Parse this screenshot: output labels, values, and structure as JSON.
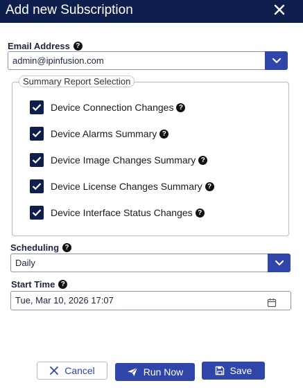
{
  "dialog": {
    "title": "Add new Subscription"
  },
  "email": {
    "label": "Email Address",
    "value": "admin@ipinfusion.com"
  },
  "summary": {
    "legend": "Summary Report Selection",
    "items": [
      {
        "label": "Device Connection Changes",
        "checked": true
      },
      {
        "label": "Device Alarms Summary",
        "checked": true
      },
      {
        "label": "Device Image Changes Summary",
        "checked": true
      },
      {
        "label": "Device License Changes Summary",
        "checked": true
      },
      {
        "label": "Device Interface Status Changes",
        "checked": true
      }
    ]
  },
  "scheduling": {
    "label": "Scheduling",
    "value": "Daily"
  },
  "start_time": {
    "label": "Start Time",
    "value": "Tue, Mar 10, 2026 17:07"
  },
  "buttons": {
    "cancel": "Cancel",
    "run_now": "Run Now",
    "save": "Save"
  },
  "colors": {
    "header": "#0f1f4d",
    "accent": "#2f45a8",
    "checkbox": "#0f1f4d"
  },
  "help_glyph": "?"
}
